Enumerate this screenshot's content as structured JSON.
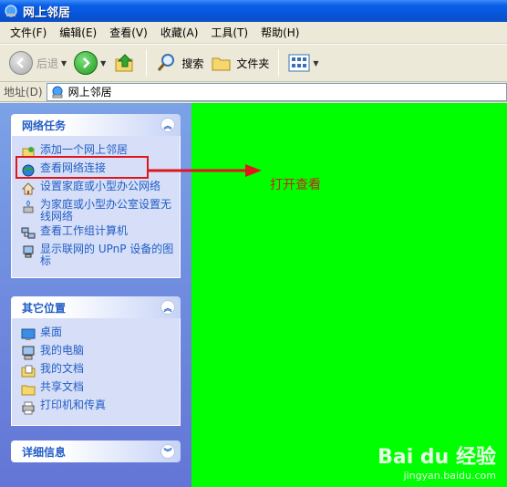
{
  "window": {
    "title": "网上邻居",
    "menu": [
      "文件(F)",
      "编辑(E)",
      "查看(V)",
      "收藏(A)",
      "工具(T)",
      "帮助(H)"
    ],
    "toolbar": {
      "back": "后退",
      "search": "搜索",
      "folders": "文件夹"
    },
    "address": {
      "label": "地址(D)",
      "value": "网上邻居"
    }
  },
  "sidebar": {
    "network_tasks": {
      "title": "网络任务",
      "items": [
        {
          "label": "添加一个网上邻居",
          "icon": "add-network-place-icon"
        },
        {
          "label": "查看网络连接",
          "icon": "network-connections-icon"
        },
        {
          "label": "设置家庭或小型办公网络",
          "icon": "home-network-icon"
        },
        {
          "label": "为家庭或小型办公室设置无线网络",
          "icon": "wireless-network-icon"
        },
        {
          "label": "查看工作组计算机",
          "icon": "workgroup-computers-icon"
        },
        {
          "label": "显示联网的 UPnP 设备的图标",
          "icon": "upnp-device-icon"
        }
      ]
    },
    "other_places": {
      "title": "其它位置",
      "items": [
        {
          "label": "桌面",
          "icon": "desktop-icon"
        },
        {
          "label": "我的电脑",
          "icon": "my-computer-icon"
        },
        {
          "label": "我的文档",
          "icon": "my-documents-icon"
        },
        {
          "label": "共享文档",
          "icon": "shared-documents-icon"
        },
        {
          "label": "打印机和传真",
          "icon": "printers-faxes-icon"
        }
      ]
    },
    "details": {
      "title": "详细信息"
    }
  },
  "annotation": {
    "text": "打开查看"
  },
  "watermark": {
    "line1": "Bai du 经验",
    "line2": "jingyan.baidu.com"
  },
  "colors": {
    "content_bg": "#00ff00",
    "highlight": "#e0161c",
    "link": "#215dc6"
  }
}
